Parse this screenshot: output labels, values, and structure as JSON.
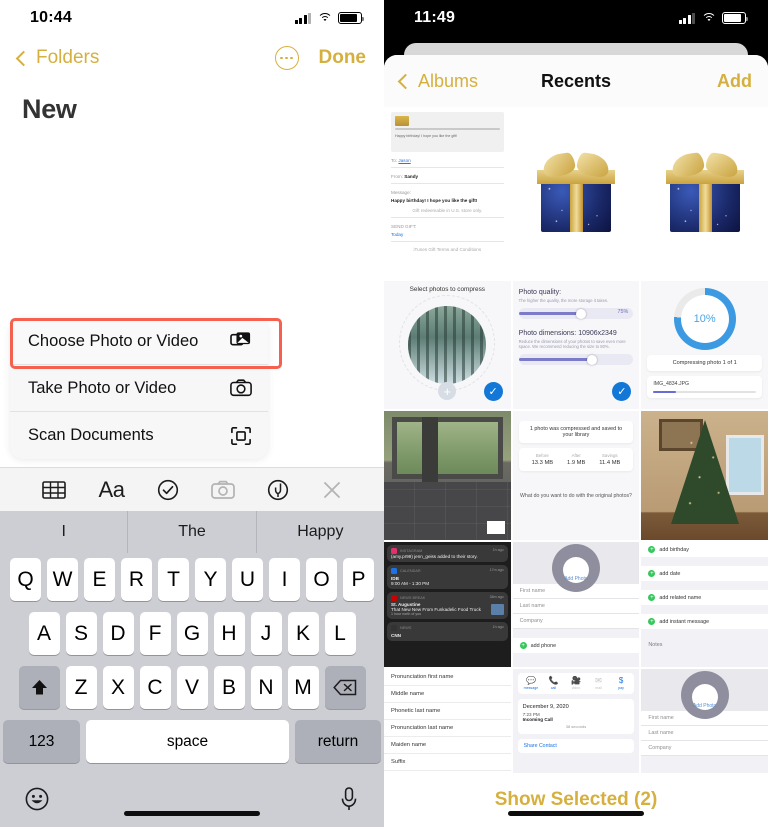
{
  "left": {
    "status": {
      "time": "10:44",
      "signal_icon": "cellular-bars-icon",
      "wifi_icon": "wifi-icon",
      "battery_icon": "battery-icon"
    },
    "nav": {
      "back_label": "Folders",
      "more_icon": "ellipsis-circle-icon",
      "done_label": "Done"
    },
    "title": "New",
    "menu": {
      "items": [
        {
          "label": "Choose Photo or Video",
          "icon": "photos-icon",
          "highlighted": true
        },
        {
          "label": "Take Photo or Video",
          "icon": "camera-icon",
          "highlighted": false
        },
        {
          "label": "Scan Documents",
          "icon": "document-scanner-icon",
          "highlighted": false
        }
      ],
      "highlight_color": "#f4614f"
    },
    "keyboard": {
      "toolbar": [
        {
          "icon": "table-icon",
          "dim": false
        },
        {
          "icon": "text-format-aa-icon",
          "label": "Aa",
          "dim": false
        },
        {
          "icon": "checklist-circle-icon",
          "dim": false
        },
        {
          "icon": "camera-icon",
          "dim": true
        },
        {
          "icon": "markup-pen-circle-icon",
          "dim": false
        },
        {
          "icon": "close-x-icon",
          "dim": true
        }
      ],
      "suggestions": [
        "I",
        "The",
        "Happy"
      ],
      "row1": [
        "Q",
        "W",
        "E",
        "R",
        "T",
        "Y",
        "U",
        "I",
        "O",
        "P"
      ],
      "row2": [
        "A",
        "S",
        "D",
        "F",
        "G",
        "H",
        "J",
        "K",
        "L"
      ],
      "row3": [
        "Z",
        "X",
        "C",
        "V",
        "B",
        "N",
        "M"
      ],
      "shift_icon": "shift-up-arrow-icon",
      "backspace_icon": "backspace-delete-icon",
      "numbers_label": "123",
      "space_label": "space",
      "return_label": "return",
      "emoji_icon": "emoji-smiley-icon",
      "dictation_icon": "microphone-icon"
    }
  },
  "right": {
    "status": {
      "time": "11:49",
      "signal_icon": "cellular-bars-icon",
      "wifi_icon": "wifi-icon",
      "battery_icon": "battery-icon"
    },
    "nav": {
      "back_label": "Albums",
      "title": "Recents",
      "add_label": "Add"
    },
    "annotation": {
      "arrow_icon": "red-pointer-arrow",
      "color": "#f0523c",
      "points_to": "Add"
    },
    "footer": {
      "show_selected_label": "Show Selected (2)"
    },
    "grid": {
      "row1": [
        {
          "name": "gift-card-screenshot",
          "type": "giftcard",
          "to_label": "To:",
          "to_value": "Jason",
          "from_label": "From:",
          "from_value": "Sandy",
          "message_label": "Message:",
          "message_value": "Happy birthday! I hope you like the gift!",
          "redeem_note": "Gift redeemable in U.S. store only.",
          "send_label": "SEND GIFT:",
          "send_value": "Today",
          "terms": "iTunes Gift Terms and Conditions"
        },
        {
          "name": "blue-gift-box-photo",
          "type": "giftbox",
          "selected": false
        },
        {
          "name": "blue-gift-box-photo",
          "type": "giftbox",
          "selected": false
        }
      ],
      "row2": [
        {
          "name": "compress-selection-screenshot",
          "type": "compress-select",
          "title": "Select photos to compress",
          "add_icon": "plus-icon",
          "check_icon": "checkmark-icon"
        },
        {
          "name": "compress-settings-screenshot",
          "type": "compress-settings",
          "quality_label": "Photo quality:",
          "quality_sub": "The higher the quality, the more storage it takes.",
          "quality_value": "75%",
          "dimensions_label": "Photo dimensions: 10906x2349",
          "dimensions_sub": "Reduce the dimensions of your photos to save even more space. We recommend reducing the size to 80%.",
          "check_icon": "checkmark-icon"
        },
        {
          "name": "compressing-progress-screenshot",
          "type": "compress-progress",
          "percent": "10%",
          "status": "Compressing photo 1 of 1",
          "file": "IMG_4834.JPG"
        }
      ],
      "row3": [
        {
          "name": "patio-window-photo",
          "type": "window-photo",
          "badge_icon": "live-photo-flag-icon"
        },
        {
          "name": "compression-result-screenshot",
          "type": "compress-result",
          "result": "1 photo was compressed and saved to your library",
          "stats": [
            {
              "label": "Before",
              "value": "13.3 MB"
            },
            {
              "label": "After",
              "value": "1.9 MB"
            },
            {
              "label": "Savings",
              "value": "11.4 MB"
            }
          ],
          "question": "What do you want to do with the original photos?"
        },
        {
          "name": "christmas-tree-photo",
          "type": "xmas"
        }
      ],
      "row4": [
        {
          "name": "notifications-screenshot",
          "type": "notifications",
          "items": [
            {
              "app": "INSTAGRAM",
              "time": "1h ago",
              "title": "",
              "body": "(amy.pr99) jenn_geiss added to their story.",
              "dark": true
            },
            {
              "app": "CALENDAR",
              "time": "17m ago",
              "title": "IDB",
              "body": "9:00 AM - 1:30 PM",
              "dark": true
            },
            {
              "app": "NEWS BREAK",
              "time": "38m ago",
              "title": "St. Augustine",
              "body": "That New New From Funkadelic Food Truck",
              "sub": "1 hour north of you",
              "dark": true
            },
            {
              "app": "NEWS",
              "time": "1h ago",
              "title": "CNN",
              "body": "",
              "dark": true
            }
          ]
        },
        {
          "name": "new-contact-screenshot",
          "type": "contact-form",
          "add_photo": "Add Photo",
          "fields": [
            "First name",
            "Last name",
            "Company"
          ],
          "add_phone": "add phone"
        },
        {
          "name": "contact-fields-screenshot",
          "type": "contact-adds",
          "adds": [
            "add birthday",
            "add date",
            "add related name",
            "add instant message"
          ],
          "notes_label": "Notes"
        }
      ],
      "row5": [
        {
          "name": "name-fields-screenshot",
          "type": "fields",
          "fields": [
            "Pronunciation first name",
            "Middle name",
            "Phonetic last name",
            "Pronunciation last name",
            "Maiden name",
            "Suffix"
          ]
        },
        {
          "name": "call-history-screenshot",
          "type": "call-history",
          "actions": [
            {
              "label": "message",
              "icon": "message-bubble-icon",
              "dim": false
            },
            {
              "label": "call",
              "icon": "phone-icon",
              "dim": false
            },
            {
              "label": "video",
              "icon": "video-camera-icon",
              "dim": true
            },
            {
              "label": "mail",
              "icon": "mail-icon",
              "dim": true
            },
            {
              "label": "pay",
              "icon": "dollar-sign-icon",
              "dim": false
            }
          ],
          "date": "December 9, 2020",
          "time": "7:23 PM",
          "type_label": "Incoming Call",
          "duration": "38 seconds",
          "share": "Share Contact"
        },
        {
          "name": "new-contact-screenshot-2",
          "type": "contact-form",
          "add_photo": "Add Photo",
          "fields": [
            "First name",
            "Last name",
            "Company"
          ],
          "add_phone": ""
        }
      ]
    }
  },
  "colors": {
    "gold": "#d6b03f",
    "red_highlight": "#f4614f",
    "blue": "#1277d6"
  }
}
